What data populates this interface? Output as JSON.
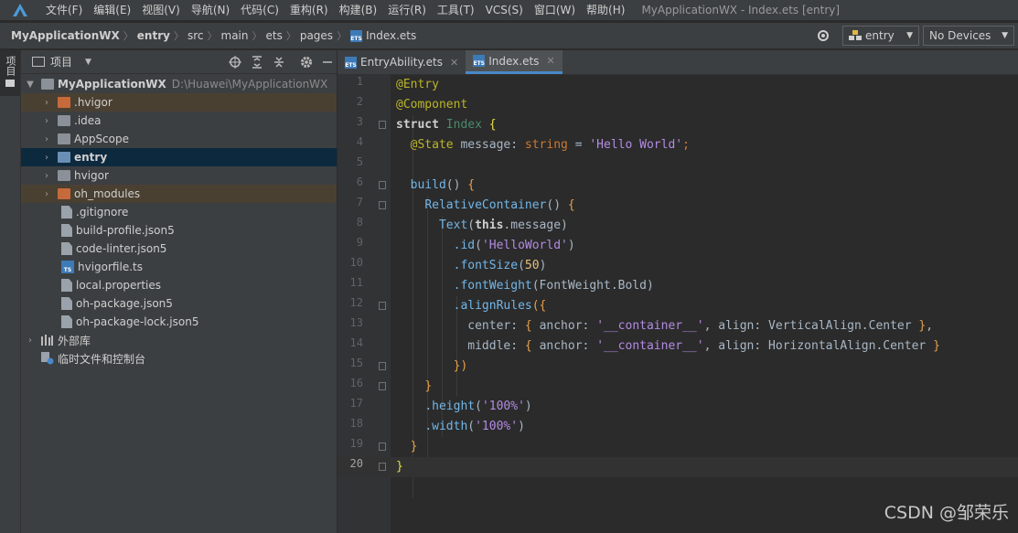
{
  "menubar": {
    "items": [
      "文件(F)",
      "编辑(E)",
      "视图(V)",
      "导航(N)",
      "代码(C)",
      "重构(R)",
      "构建(B)",
      "运行(R)",
      "工具(T)",
      "VCS(S)",
      "窗口(W)",
      "帮助(H)"
    ],
    "window_title": "MyApplicationWX - Index.ets [entry]"
  },
  "navbar": {
    "crumbs": [
      "MyApplicationWX",
      "entry",
      "src",
      "main",
      "ets",
      "pages",
      "Index.ets"
    ],
    "run_config": "entry",
    "device": "No Devices"
  },
  "left_strip": {
    "tab_label": "项目"
  },
  "project": {
    "title": "项目",
    "tree": [
      {
        "label": "MyApplicationWX",
        "path": "D:\\Huawei\\MyApplicationWX",
        "kind": "root"
      },
      {
        "label": ".hvigor",
        "kind": "folder-orange"
      },
      {
        "label": ".idea",
        "kind": "folder"
      },
      {
        "label": "AppScope",
        "kind": "folder"
      },
      {
        "label": "entry",
        "kind": "folder-blue"
      },
      {
        "label": "hvigor",
        "kind": "folder"
      },
      {
        "label": "oh_modules",
        "kind": "folder-orange"
      },
      {
        "label": ".gitignore",
        "kind": "file"
      },
      {
        "label": "build-profile.json5",
        "kind": "file"
      },
      {
        "label": "code-linter.json5",
        "kind": "file"
      },
      {
        "label": "hvigorfile.ts",
        "kind": "ts"
      },
      {
        "label": "local.properties",
        "kind": "file"
      },
      {
        "label": "oh-package.json5",
        "kind": "file"
      },
      {
        "label": "oh-package-lock.json5",
        "kind": "file"
      },
      {
        "label": "外部库",
        "kind": "lib"
      },
      {
        "label": "临时文件和控制台",
        "kind": "scratch"
      }
    ]
  },
  "editor": {
    "tabs": [
      {
        "label": "EntryAbility.ets",
        "active": false
      },
      {
        "label": "Index.ets",
        "active": true
      }
    ],
    "line_numbers": [
      "1",
      "2",
      "3",
      "4",
      "5",
      "6",
      "7",
      "8",
      "9",
      "10",
      "11",
      "12",
      "13",
      "14",
      "15",
      "16",
      "17",
      "18",
      "19",
      "20"
    ],
    "current_line": 20
  },
  "code": {
    "l1": "@Entry",
    "l2": "@Component",
    "l3_kw": "struct",
    "l3_name": "Index",
    "l3_brace": "{",
    "l4_dec": "@State",
    "l4_name": "message",
    "l4_type": "string",
    "l4_eq": "=",
    "l4_val": "'Hello World'",
    "l4_end": ";",
    "l6_fn": "build",
    "l6_rest": "() {",
    "l7_fn": "RelativeContainer",
    "l7_rest": "() {",
    "l8_fn": "Text",
    "l8_open": "(",
    "l8_this": "this",
    "l8_prop": ".message",
    "l8_close": ")",
    "l9_m": ".id",
    "l9_arg": "'HelloWorld'",
    "l10_m": ".fontSize",
    "l10_arg": "50",
    "l11_m": ".fontWeight",
    "l11_arg": "FontWeight.Bold",
    "l12_m": ".alignRules",
    "l12_rest": "({",
    "l13_key": "center",
    "l13_a": "anchor",
    "l13_av": "'__container__'",
    "l13_b": "align",
    "l13_bv": "VerticalAlign.Center",
    "l14_key": "middle",
    "l14_a": "anchor",
    "l14_av": "'__container__'",
    "l14_b": "align",
    "l14_bv": "HorizontalAlign.Center",
    "l15": "})",
    "l16": "}",
    "l17_m": ".height",
    "l17_arg": "'100%'",
    "l18_m": ".width",
    "l18_arg": "'100%'",
    "l19": "}",
    "l20": "}"
  },
  "watermark": "CSDN @邹荣乐"
}
